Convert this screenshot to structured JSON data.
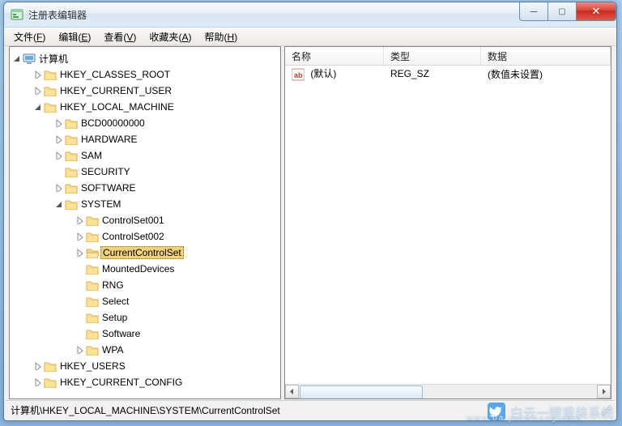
{
  "window": {
    "title": "注册表编辑器"
  },
  "menus": {
    "file": {
      "label": "文件",
      "key": "F"
    },
    "edit": {
      "label": "编辑",
      "key": "E"
    },
    "view": {
      "label": "查看",
      "key": "V"
    },
    "fav": {
      "label": "收藏夹",
      "key": "A"
    },
    "help": {
      "label": "帮助",
      "key": "H"
    }
  },
  "tree": {
    "root": "计算机",
    "hkcr": "HKEY_CLASSES_ROOT",
    "hkcu": "HKEY_CURRENT_USER",
    "hklm": "HKEY_LOCAL_MACHINE",
    "hklm_children": {
      "bcd": "BCD00000000",
      "hardware": "HARDWARE",
      "sam": "SAM",
      "security": "SECURITY",
      "software": "SOFTWARE",
      "system": "SYSTEM"
    },
    "system_children": {
      "cs001": "ControlSet001",
      "cs002": "ControlSet002",
      "ccs": "CurrentControlSet",
      "mounted": "MountedDevices",
      "rng": "RNG",
      "select": "Select",
      "setup": "Setup",
      "sw": "Software",
      "wpa": "WPA"
    },
    "hku": "HKEY_USERS",
    "hkcc": "HKEY_CURRENT_CONFIG"
  },
  "list": {
    "headers": {
      "name": "名称",
      "type": "类型",
      "data": "数据"
    },
    "widths": {
      "name": 122,
      "type": 120,
      "data": 160
    },
    "rows": [
      {
        "name": "(默认)",
        "type": "REG_SZ",
        "data": "(数值未设置)"
      }
    ]
  },
  "status": {
    "path": "计算机\\HKEY_LOCAL_MACHINE\\SYSTEM\\CurrentControlSet"
  },
  "watermark": {
    "text": "白云一键重装系统",
    "sub": "www.baiyunxitong.com"
  }
}
